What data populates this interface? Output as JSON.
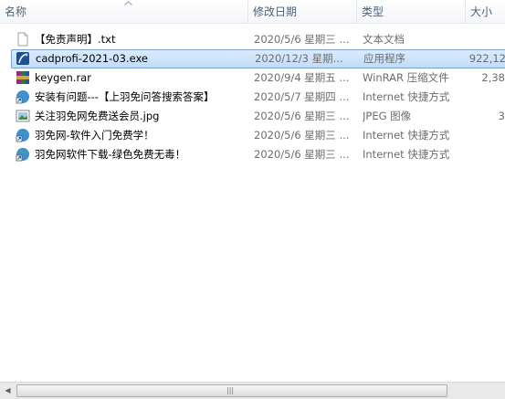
{
  "columns": {
    "name": "名称",
    "date": "修改日期",
    "type": "类型",
    "size": "大小"
  },
  "files": [
    {
      "name": "【免责声明】.txt",
      "date": "2020/5/6 星期三 ...",
      "type": "文本文档",
      "size": "",
      "icon": "text-file-icon"
    },
    {
      "name": "cadprofi-2021-03.exe",
      "date": "2020/12/3 星期...",
      "type": "应用程序",
      "size": "922,12",
      "icon": "exe-app-icon",
      "selected": true
    },
    {
      "name": "keygen.rar",
      "date": "2020/9/4 星期五 ...",
      "type": "WinRAR 压缩文件",
      "size": "2,38",
      "icon": "rar-archive-icon"
    },
    {
      "name": "安装有问题---【上羽免问答搜索答案】",
      "date": "2020/5/7 星期四 ...",
      "type": "Internet 快捷方式",
      "size": "",
      "icon": "internet-shortcut-icon"
    },
    {
      "name": "关注羽免网免费送会员.jpg",
      "date": "2020/5/6 星期三 ...",
      "type": "JPEG 图像",
      "size": "3",
      "icon": "jpeg-image-icon"
    },
    {
      "name": "羽免网-软件入门免费学！",
      "date": "2020/5/6 星期三 ...",
      "type": "Internet 快捷方式",
      "size": "",
      "icon": "internet-shortcut-icon"
    },
    {
      "name": "羽免网软件下载-绿色免费无毒！",
      "date": "2020/5/6 星期三 ...",
      "type": "Internet 快捷方式",
      "size": "",
      "icon": "internet-shortcut-icon"
    }
  ],
  "scrollbar": {
    "left_arrow": "◀",
    "grip": "|||"
  },
  "colors": {
    "selection": "#c1dcfc",
    "header_text": "#4c607a",
    "meta_text": "#6d6d6d"
  }
}
